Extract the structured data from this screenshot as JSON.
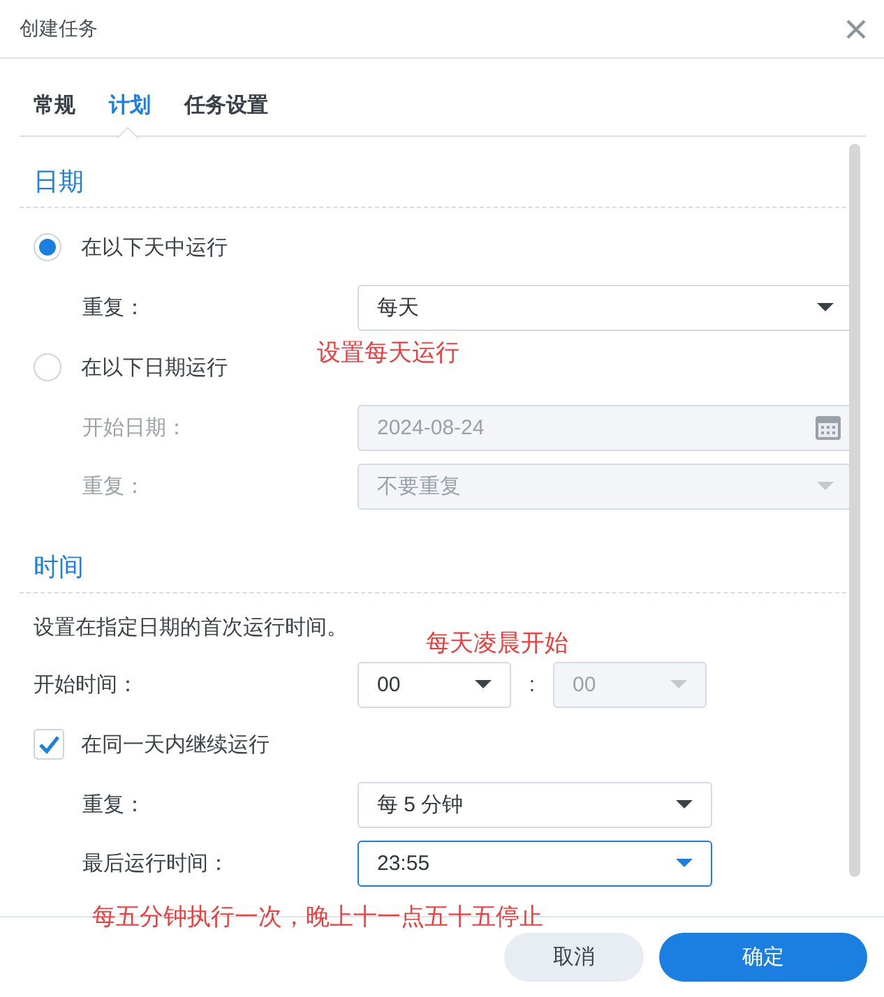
{
  "window": {
    "title": "创建任务"
  },
  "tabs": [
    {
      "label": "常规",
      "selected": false
    },
    {
      "label": "计划",
      "selected": true
    },
    {
      "label": "任务设置",
      "selected": false
    }
  ],
  "date_section": {
    "title": "日期",
    "options": [
      {
        "label": "在以下天中运行",
        "selected": true,
        "fields": [
          {
            "label": "重复：",
            "value": "每天",
            "kind": "select",
            "disabled": false
          }
        ]
      },
      {
        "label": "在以下日期运行",
        "selected": false,
        "fields": [
          {
            "label": "开始日期：",
            "value": "2024-08-24",
            "kind": "date",
            "disabled": true
          },
          {
            "label": "重复：",
            "value": "不要重复",
            "kind": "select",
            "disabled": true
          }
        ]
      }
    ]
  },
  "time_section": {
    "title": "时间",
    "description": "设置在指定日期的首次运行时间。",
    "start_time": {
      "label": "开始时间：",
      "hour": {
        "value": "00",
        "disabled": false
      },
      "separator": ":",
      "minute": {
        "value": "00",
        "disabled": true
      }
    },
    "continue": {
      "label": "在同一天内继续运行",
      "checked": true,
      "fields": [
        {
          "label": "重复：",
          "value": "每 5 分钟",
          "kind": "select",
          "disabled": false,
          "focused": false
        },
        {
          "label": "最后运行时间：",
          "value": "23:55",
          "kind": "select",
          "disabled": false,
          "focused": true
        }
      ]
    }
  },
  "annotations": [
    {
      "text": "设置每天运行"
    },
    {
      "text": "每天凌晨开始"
    },
    {
      "text": "每五分钟执行一次，晚上十一点五十五停止"
    }
  ],
  "buttons": [
    {
      "label": "取消",
      "kind": "secondary"
    },
    {
      "label": "确定",
      "kind": "primary"
    }
  ]
}
